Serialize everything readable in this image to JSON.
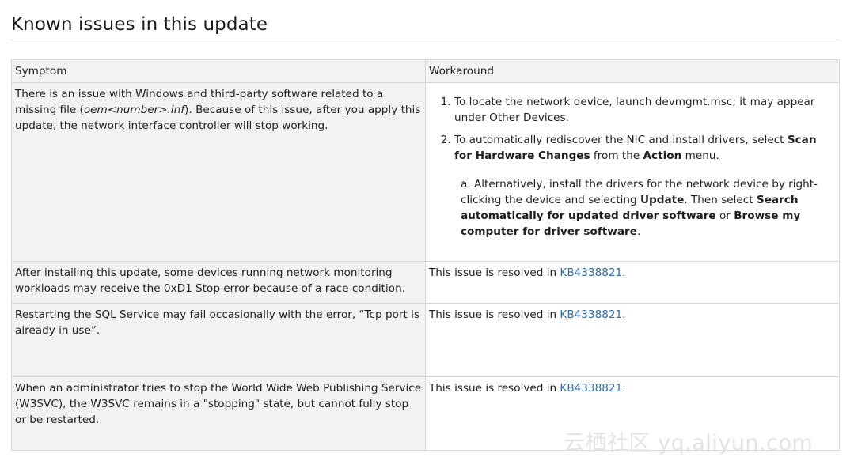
{
  "section": {
    "title": "Known issues in this update"
  },
  "table": {
    "headers": {
      "symptom": "Symptom",
      "workaround": "Workaround"
    },
    "row1": {
      "symptom_part1": "There is an issue with Windows and third-party software related to a missing file (",
      "symptom_italic": "oem<number>.inf",
      "symptom_part2": "). Because of this issue, after you apply this update, the network interface controller will stop working.",
      "step1": "To locate the network device, launch devmgmt.msc; it may appear under Other Devices.",
      "step2_pre": "To automatically rediscover the NIC and install drivers, select ",
      "step2_bold1": "Scan for Hardware Changes",
      "step2_mid": " from the ",
      "step2_bold2": "Action",
      "step2_post": " menu.",
      "sub_pre": "a. Alternatively, install the drivers for the network device by right-clicking the device and selecting ",
      "sub_bold1": "Update",
      "sub_mid1": ". Then select ",
      "sub_bold2": "Search automatically for updated driver software",
      "sub_mid2": " or ",
      "sub_bold3": "Browse my computer for driver software",
      "sub_post": "."
    },
    "row2": {
      "symptom": "After installing this update, some devices running network monitoring workloads may receive the 0xD1 Stop error because of a race condition.",
      "workaround_pre": "This issue is resolved in ",
      "workaround_link": "KB4338821",
      "workaround_post": "."
    },
    "row3": {
      "symptom": "Restarting the SQL Service may fail occasionally with the error, “Tcp port is already in use”.",
      "workaround_pre": "This issue is resolved in ",
      "workaround_link": "KB4338821",
      "workaround_post": "."
    },
    "row4": {
      "symptom": "When an administrator tries to stop the World Wide Web Publishing Service (W3SVC), the W3SVC remains in a \"stopping\" state, but cannot fully stop or be restarted.",
      "workaround_pre": "This issue is resolved in ",
      "workaround_link": "KB4338821",
      "workaround_post": "."
    }
  },
  "watermark": "云栖社区 yq.aliyun.com",
  "colors": {
    "link": "#2f6fa8",
    "symptom_bg": "#f2f2f2",
    "border": "#d8d8d8"
  }
}
